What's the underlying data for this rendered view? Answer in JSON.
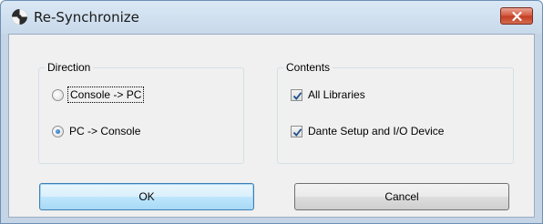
{
  "window": {
    "title": "Re-Synchronize",
    "app_icon": "app-icon",
    "close_icon": "close-x-icon",
    "accent_color": "#c43c21"
  },
  "direction": {
    "label": "Direction",
    "options": [
      {
        "label": "Console -> PC",
        "selected": false
      },
      {
        "label": "PC -> Console",
        "selected": true
      }
    ]
  },
  "contents": {
    "label": "Contents",
    "options": [
      {
        "label": "All Libraries",
        "checked": true
      },
      {
        "label": "Dante Setup and I/O Device",
        "checked": true
      }
    ]
  },
  "buttons": {
    "ok_label": "OK",
    "cancel_label": "Cancel"
  }
}
